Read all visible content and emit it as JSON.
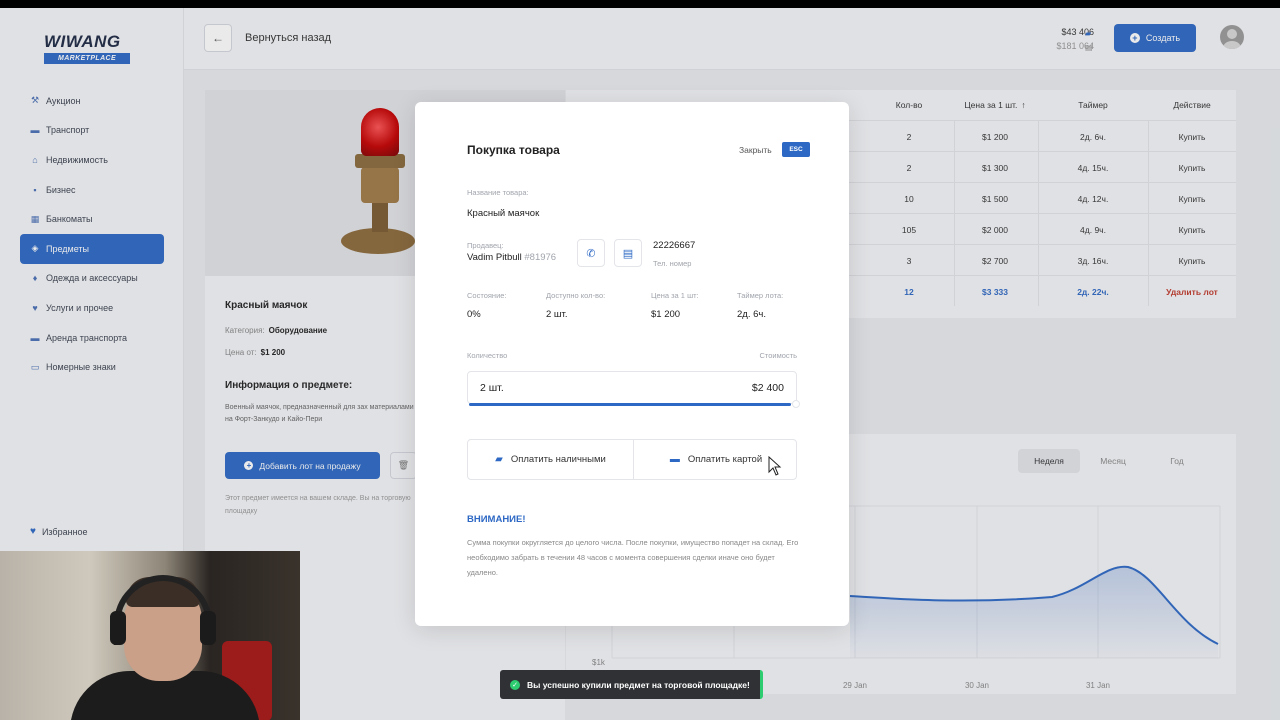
{
  "brand": {
    "name": "WIWANG",
    "sub": "MARKETPLACE"
  },
  "sidebar": {
    "items": [
      {
        "label": "Аукцион",
        "icon": "auction-icon",
        "active": false
      },
      {
        "label": "Транспорт",
        "icon": "car-icon",
        "active": false
      },
      {
        "label": "Недвижимость",
        "icon": "house-icon",
        "active": false
      },
      {
        "label": "Бизнес",
        "icon": "briefcase-icon",
        "active": false
      },
      {
        "label": "Банкоматы",
        "icon": "atm-icon",
        "active": false
      },
      {
        "label": "Предметы",
        "icon": "box-icon",
        "active": true
      },
      {
        "label": "Одежда и аксессуары",
        "icon": "shirt-icon",
        "active": false
      },
      {
        "label": "Услуги и прочее",
        "icon": "service-icon",
        "active": false
      },
      {
        "label": "Аренда транспорта",
        "icon": "rent-icon",
        "active": false
      },
      {
        "label": "Номерные знаки",
        "icon": "plate-icon",
        "active": false
      }
    ],
    "favorites": "Избранное"
  },
  "header": {
    "back_label": "Вернуться назад",
    "balance_cash": "$43 406",
    "balance_bank": "$181 064",
    "create_label": "Создать"
  },
  "item": {
    "name": "Красный маячок",
    "category_label": "Категория:",
    "category_value": "Оборудование",
    "price_label": "Цена от:",
    "price_value": "$1 200",
    "info_title": "Информация о предмете:",
    "info_text": "Военный маячок, предназначенный для зах материалами на Форт-Занкудо и Кайо-Пери",
    "add_lot_label": "Добавить лот на продажу",
    "stock_note": "Этот предмет имеется на вашем складе. Вы на торговую площадку"
  },
  "table": {
    "headers": [
      "Кол-во",
      "Цена за 1 шт.",
      "Таймер",
      "Действие"
    ],
    "rows": [
      {
        "qty": "2",
        "price": "$1 200",
        "timer": "2д. 6ч.",
        "action": "Купить",
        "mine": false
      },
      {
        "qty": "2",
        "price": "$1 300",
        "timer": "4д. 15ч.",
        "action": "Купить",
        "mine": false
      },
      {
        "qty": "10",
        "price": "$1 500",
        "timer": "4д. 12ч.",
        "action": "Купить",
        "mine": false
      },
      {
        "qty": "105",
        "price": "$2 000",
        "timer": "4д. 9ч.",
        "action": "Купить",
        "mine": false
      },
      {
        "qty": "3",
        "price": "$2 700",
        "timer": "3д. 16ч.",
        "action": "Купить",
        "mine": false
      },
      {
        "qty": "12",
        "price": "$3 333",
        "timer": "2д. 22ч.",
        "action": "Удалить лот",
        "mine": true
      }
    ]
  },
  "chart": {
    "tabs": [
      "Неделя",
      "Месяц",
      "Год"
    ],
    "active_tab": "Неделя",
    "ytick": "$1k",
    "xticks": [
      "29 Jan",
      "30 Jan",
      "31 Jan"
    ]
  },
  "chart_data": {
    "type": "area",
    "x": [
      "29 Jan",
      "30 Jan",
      "31 Jan"
    ],
    "series": [
      {
        "values": []
      }
    ]
  },
  "modal": {
    "title": "Покупка товара",
    "close_label": "Закрыть",
    "esc_label": "ESC",
    "item_name_label": "Название товара:",
    "item_name_value": "Красный маячок",
    "seller_label": "Продавец:",
    "seller_name": "Vadim Pitbull",
    "seller_id": "#81976",
    "phone_value": "22226667",
    "phone_label": "Тел. номер",
    "condition_label": "Состояние:",
    "condition_value": "0%",
    "available_label": "Доступно кол-во:",
    "available_value": "2 шт.",
    "unit_price_label": "Цена за 1 шт:",
    "unit_price_value": "$1 200",
    "timer_label": "Таймер лота:",
    "timer_value": "2д. 6ч.",
    "quantity_label": "Количество",
    "cost_label": "Стоимость",
    "quantity_value": "2 шт.",
    "cost_value": "$2 400",
    "quantity_fraction": 1.0,
    "pay_cash": "Оплатить наличными",
    "pay_card": "Оплатить картой",
    "warning_title": "ВНИМАНИЕ!",
    "warning_text": "Сумма покупки округляется до целого числа. После покупки, имущество попадет на склад. Его необходимо забрать в течении 48 часов с момента совершения сделки иначе оно будет удалено."
  },
  "toast": {
    "text": "Вы успешно купили предмет на торговой площадке!"
  },
  "colors": {
    "accent": "#2d68c4",
    "danger": "#c0392b",
    "success": "#2ecc71"
  }
}
